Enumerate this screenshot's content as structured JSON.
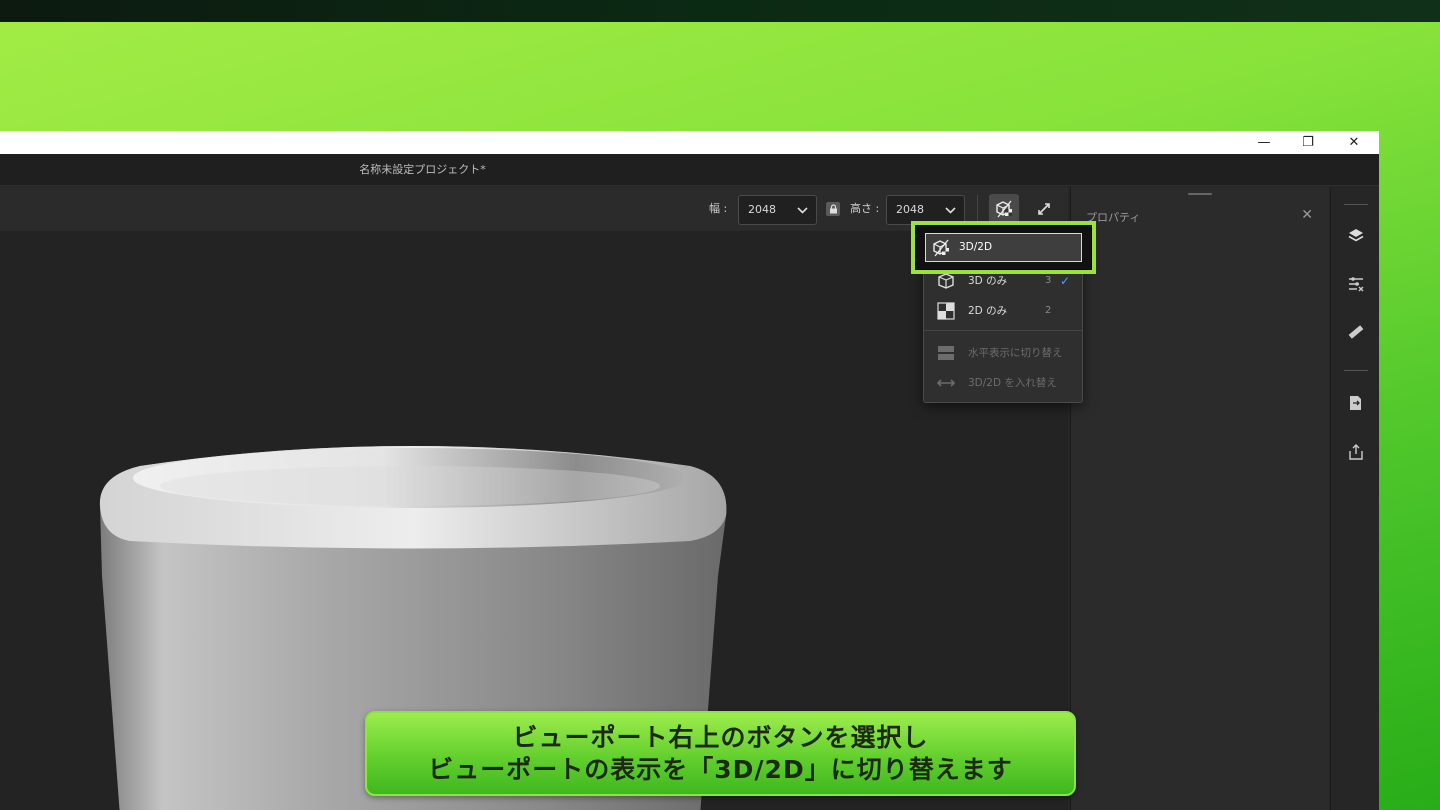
{
  "window": {
    "title": "名称未設定プロジェクト*",
    "controls": {
      "minimize": "—",
      "restore": "❐",
      "close": "✕"
    }
  },
  "toolbar": {
    "width_label": "幅 :",
    "width_value": "2048",
    "height_label": "高さ :",
    "height_value": "2048"
  },
  "properties_panel": {
    "title": "プロパティ"
  },
  "view_menu": {
    "items": [
      {
        "label": "3D/2D",
        "shortcut": "",
        "checked": false,
        "enabled": true,
        "icon": "3d-2d-icon",
        "highlighted": true
      },
      {
        "label": "3D のみ",
        "shortcut": "3",
        "checked": true,
        "enabled": true,
        "icon": "3d-cube-icon"
      },
      {
        "label": "2D のみ",
        "shortcut": "2",
        "checked": false,
        "enabled": true,
        "icon": "2d-checker-icon"
      },
      {
        "label": "水平表示に切り替え",
        "shortcut": "",
        "checked": false,
        "enabled": false,
        "icon": "horizontal-split-icon"
      },
      {
        "label": "3D/2D を入れ替え",
        "shortcut": "",
        "checked": false,
        "enabled": false,
        "icon": "swap-icon"
      }
    ]
  },
  "right_rail": {
    "icons": [
      "layers-icon",
      "adjustments-icon",
      "measure-icon",
      "export-document-icon",
      "share-icon"
    ]
  },
  "caption": {
    "line1": "ビューポート右上のボタンを選択し",
    "line2": "ビューポートの表示を「3D/2D」に切り替えます"
  },
  "colors": {
    "accent_green": "#9be23c",
    "check_blue": "#4aa3ff",
    "app_background": "#262626"
  }
}
